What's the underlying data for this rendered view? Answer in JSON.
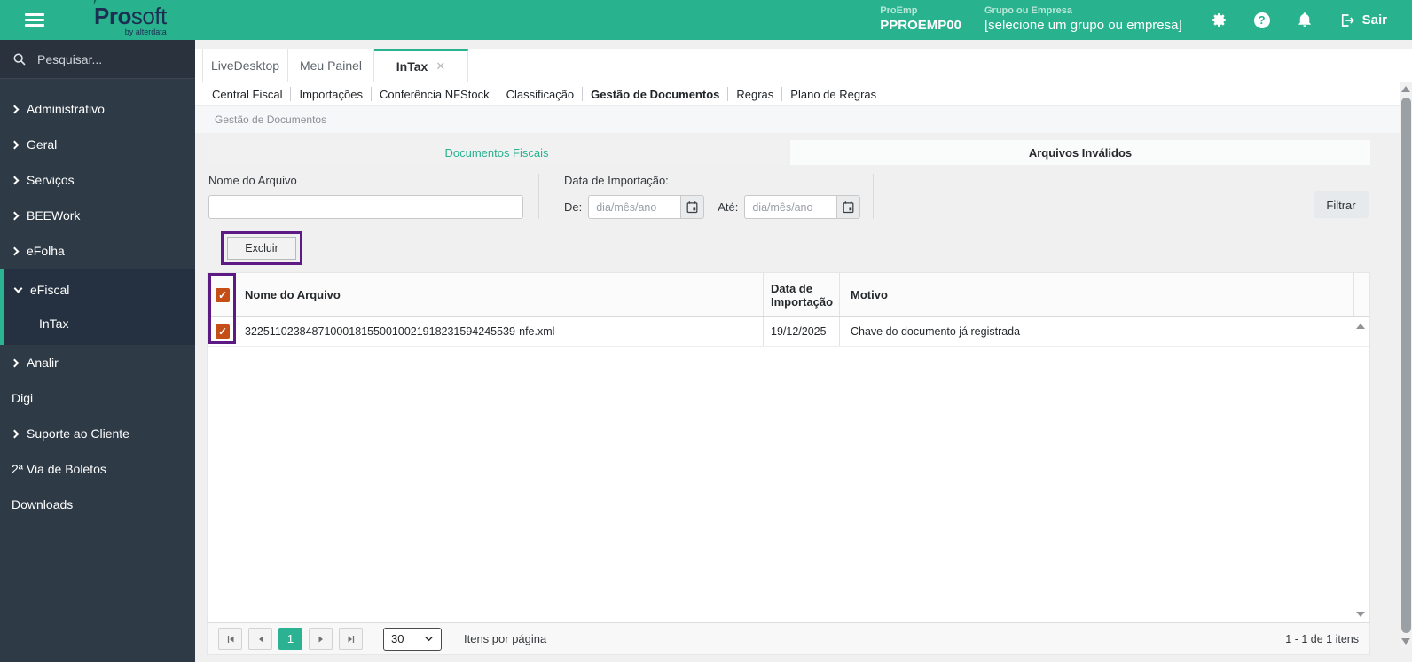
{
  "topbar": {
    "logo_pro": "Pro",
    "logo_soft": "soft",
    "logo_by": "by alterdata",
    "proemp_label": "ProEmp",
    "proemp_value": "PPROEMP00",
    "grupo_label": "Grupo ou Empresa",
    "grupo_value": "[selecione um grupo ou empresa]",
    "sair_label": "Sair"
  },
  "sidebar": {
    "search_placeholder": "Pesquisar...",
    "items": [
      {
        "label": "Administrativo"
      },
      {
        "label": "Geral"
      },
      {
        "label": "Serviços"
      },
      {
        "label": "BEEWork"
      },
      {
        "label": "eFolha"
      },
      {
        "label": "eFiscal",
        "children": [
          {
            "label": "InTax"
          }
        ]
      },
      {
        "label": "Analir"
      },
      {
        "label": "Digi"
      },
      {
        "label": "Suporte ao Cliente"
      },
      {
        "label": "2ª Via de Boletos"
      },
      {
        "label": "Downloads"
      }
    ]
  },
  "tabs": {
    "items": [
      {
        "label": "LiveDesktop"
      },
      {
        "label": "Meu Painel"
      },
      {
        "label": "InTax",
        "active": true,
        "close": "✕"
      }
    ]
  },
  "subtabs": {
    "items": [
      "Central Fiscal",
      "Importações",
      "Conferência NFStock",
      "Classificação",
      "Gestão de Documentos",
      "Regras",
      "Plano de Regras"
    ],
    "active": "Gestão de Documentos"
  },
  "breadcrumb": {
    "label": "Gestão de Documentos"
  },
  "doc_tabs": {
    "fiscais": "Documentos Fiscais",
    "invalidos": "Arquivos Inválidos"
  },
  "filters": {
    "nome_label": "Nome do Arquivo",
    "data_label": "Data de Importação:",
    "de_label": "De:",
    "ate_label": "Até:",
    "date_placeholder": "dia/mês/ano",
    "filtrar_label": "Filtrar",
    "excluir_label": "Excluir"
  },
  "table": {
    "columns": [
      "Nome do Arquivo",
      "Data de Importação",
      "Motivo"
    ],
    "select_all_checked": true,
    "check_glyph": "✓",
    "rows": [
      {
        "checked": true,
        "nome": "32251102384871000181550010021918231594245539-nfe.xml",
        "data": "19/12/2025",
        "motivo": "Chave do documento já registrada"
      }
    ]
  },
  "pagination": {
    "current_page": "1",
    "page_size": "30",
    "per_page_label": "Itens por página",
    "range_label": "1 - 1 de 1 itens"
  },
  "colors": {
    "brand_teal": "#28b28e",
    "sidebar_dark": "#2e3a46",
    "annotation_purple": "#5d1a85",
    "checkbox_orange": "#c54e17"
  }
}
